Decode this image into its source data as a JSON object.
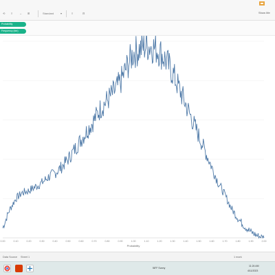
{
  "toolbar": {
    "items": [
      "⟲",
      "≡",
      "↔",
      "⊞",
      "Standard",
      "▾",
      "≡",
      "⊟"
    ],
    "share_label": "Show Me",
    "logo_color": "#e8a33c"
  },
  "shelves": {
    "columns_label": "Columns",
    "rows_label": "Rows",
    "columns_pill": "Probability",
    "rows_pill": "Frequency (bin)",
    "pill_color": "#1ab38a"
  },
  "chart_data": {
    "type": "line",
    "title": "",
    "xlabel": "Probability",
    "ylabel": "",
    "xlim": [
      0.0,
      2.0
    ],
    "grid": true,
    "x_ticks": [
      "0.00",
      "0.10",
      "0.20",
      "0.30",
      "0.40",
      "0.50",
      "0.60",
      "0.70",
      "0.80",
      "0.90",
      "1.00",
      "1.10",
      "1.20",
      "1.30",
      "1.40",
      "1.50",
      "1.60",
      "1.70",
      "1.80",
      "1.90",
      "2.00"
    ],
    "series": [
      {
        "color": "#4e79a7",
        "x": [
          0.0,
          0.05,
          0.1,
          0.15,
          0.2,
          0.25,
          0.3,
          0.35,
          0.4,
          0.45,
          0.5,
          0.55,
          0.6,
          0.65,
          0.7,
          0.75,
          0.8,
          0.85,
          0.9,
          0.95,
          1.0,
          1.05,
          1.1,
          1.15,
          1.2,
          1.25,
          1.3,
          1.35,
          1.4,
          1.45,
          1.5,
          1.55,
          1.6,
          1.65,
          1.7,
          1.75,
          1.8,
          1.85,
          1.9,
          1.95,
          2.0
        ],
        "values": [
          5,
          14,
          20,
          23,
          24,
          26,
          28,
          31,
          33,
          36,
          40,
          45,
          50,
          55,
          60,
          66,
          70,
          74,
          79,
          87,
          94,
          96,
          98,
          97,
          95,
          90,
          84,
          76,
          68,
          60,
          52,
          44,
          36,
          28,
          22,
          15,
          10,
          6,
          3,
          1,
          0
        ]
      }
    ]
  },
  "statusbar": {
    "sheet_tabs": [
      "Data Source",
      "Sheet 1"
    ],
    "info": "1 mark"
  },
  "taskbar": {
    "weather": "58°F Sunny",
    "time": "11:24 AM",
    "date": "4/11/2023"
  }
}
